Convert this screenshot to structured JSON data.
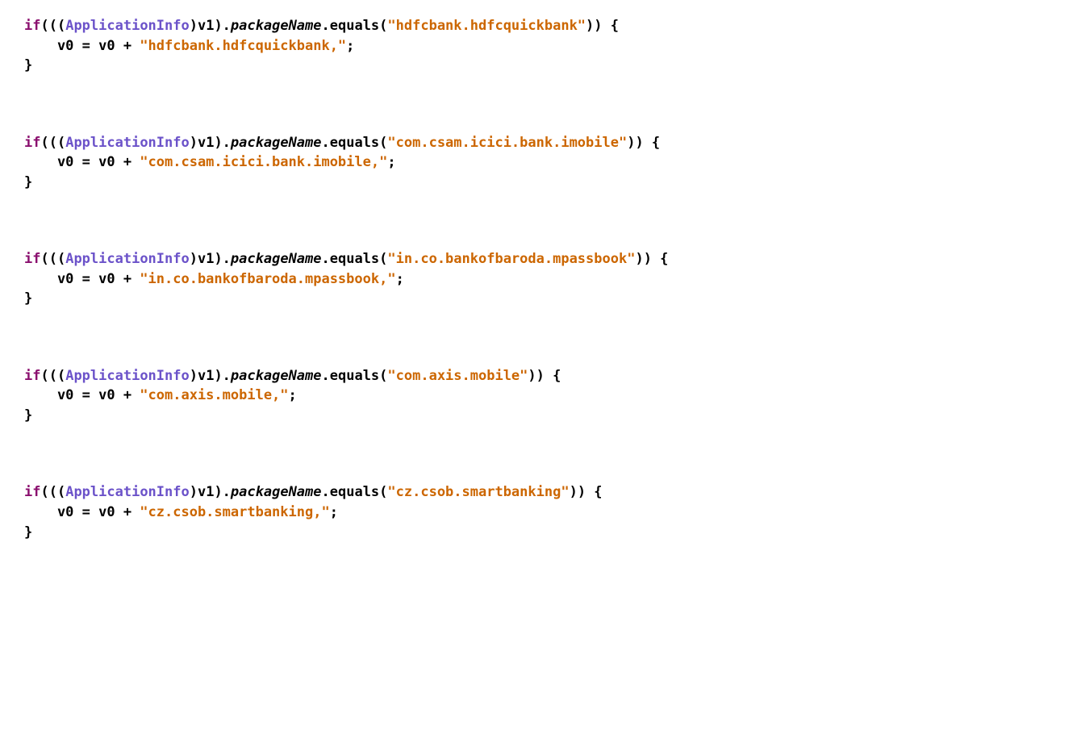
{
  "code_blocks": [
    {
      "keyword": "if",
      "type": "ApplicationInfo",
      "var_cast": "v1",
      "field": "packageName",
      "method": "equals",
      "string_arg": "\"hdfcbank.hdfcquickbank\"",
      "assign_lhs": "v0 = v0 + ",
      "assign_rhs": "\"hdfcbank.hdfcquickbank,\""
    },
    {
      "keyword": "if",
      "type": "ApplicationInfo",
      "var_cast": "v1",
      "field": "packageName",
      "method": "equals",
      "string_arg": "\"com.csam.icici.bank.imobile\"",
      "assign_lhs": "v0 = v0 + ",
      "assign_rhs": "\"com.csam.icici.bank.imobile,\""
    },
    {
      "keyword": "if",
      "type": "ApplicationInfo",
      "var_cast": "v1",
      "field": "packageName",
      "method": "equals",
      "string_arg": "\"in.co.bankofbaroda.mpassbook\"",
      "assign_lhs": "v0 = v0 + ",
      "assign_rhs": "\"in.co.bankofbaroda.mpassbook,\""
    },
    {
      "keyword": "if",
      "type": "ApplicationInfo",
      "var_cast": "v1",
      "field": "packageName",
      "method": "equals",
      "string_arg": "\"com.axis.mobile\"",
      "assign_lhs": "v0 = v0 + ",
      "assign_rhs": "\"com.axis.mobile,\""
    },
    {
      "keyword": "if",
      "type": "ApplicationInfo",
      "var_cast": "v1",
      "field": "packageName",
      "method": "equals",
      "string_arg": "\"cz.csob.smartbanking\"",
      "assign_lhs": "v0 = v0 + ",
      "assign_rhs": "\"cz.csob.smartbanking,\""
    }
  ]
}
